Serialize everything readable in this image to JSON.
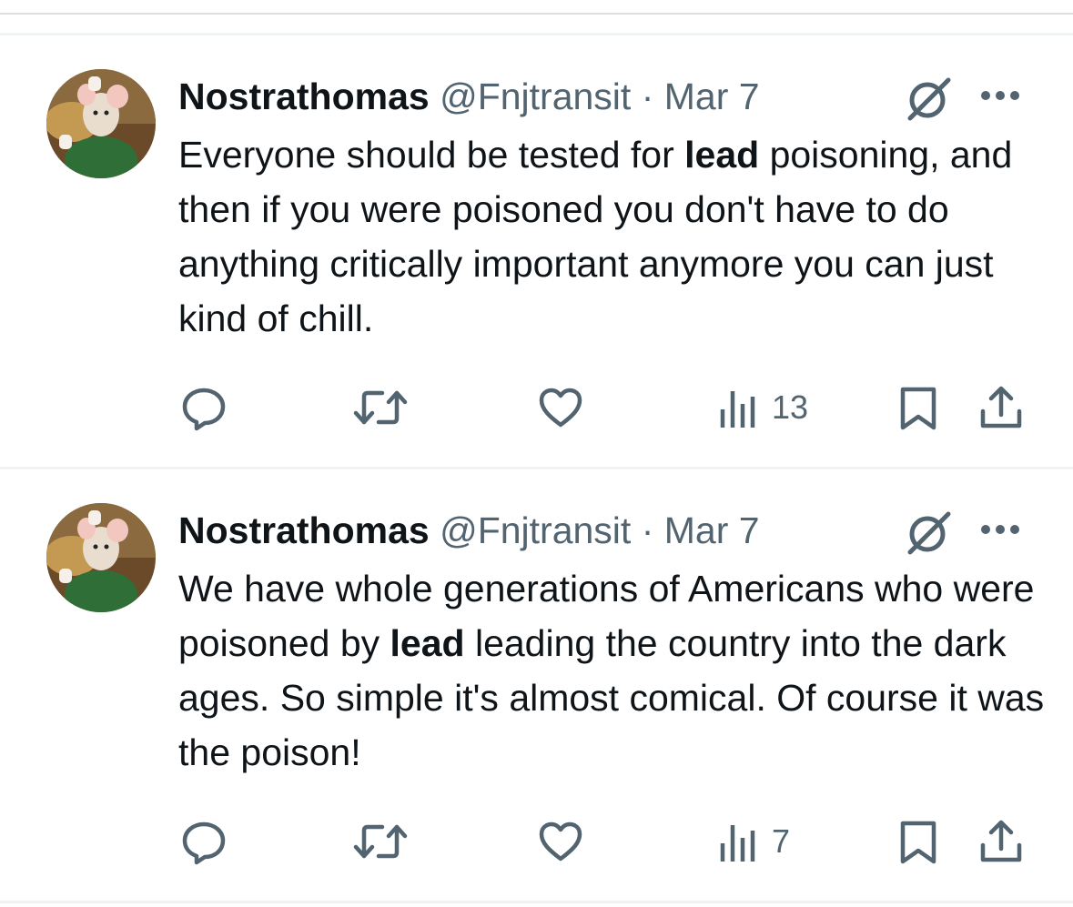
{
  "tweets": [
    {
      "display_name": "Nostrathomas",
      "handle": "@Fnjtransit",
      "separator": "·",
      "date": "Mar 7",
      "text_before": "Everyone should be tested for ",
      "text_bold": "lead",
      "text_after": " poisoning, and then if you were poisoned you don't have to do anything critically important anymore you can just kind of chill.",
      "views": "13"
    },
    {
      "display_name": "Nostrathomas",
      "handle": "@Fnjtransit",
      "separator": "·",
      "date": "Mar 7",
      "text_before": "We have whole generations of Americans who were poisoned by ",
      "text_bold": "lead",
      "text_after": " leading the country into the dark ages. So simple it's almost comical. Of course it was the poison!",
      "views": "7"
    }
  ],
  "icons": {
    "reply": "reply-icon",
    "retweet": "retweet-icon",
    "like": "like-icon",
    "views": "views-icon",
    "bookmark": "bookmark-icon",
    "share": "share-icon",
    "grok": "grok-icon",
    "more": "more-icon"
  },
  "colors": {
    "text": "#0f1419",
    "secondary": "#536471",
    "divider": "#eff3f4"
  }
}
